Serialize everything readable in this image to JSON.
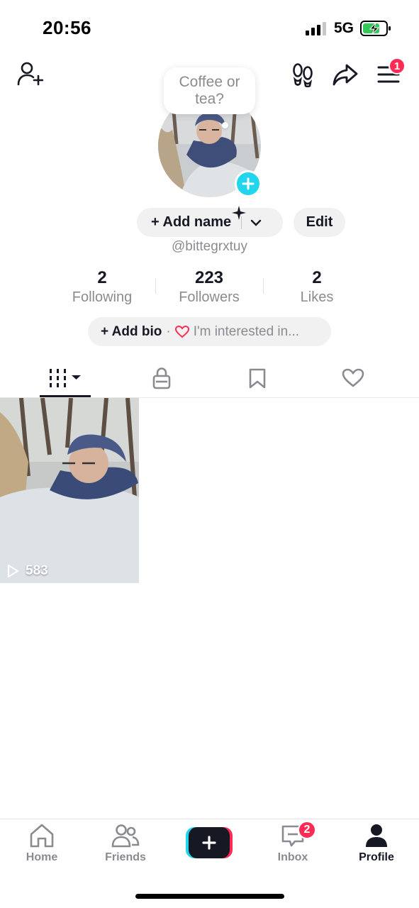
{
  "status_bar": {
    "time": "20:56",
    "network": "5G"
  },
  "header": {
    "menu_badge": "1"
  },
  "bubble": {
    "text": "Coffee or tea?"
  },
  "profile": {
    "add_name_label": "+ Add name",
    "edit_label": "Edit",
    "username": "@bittegrxtuy"
  },
  "stats": [
    {
      "value": "2",
      "label": "Following"
    },
    {
      "value": "223",
      "label": "Followers"
    },
    {
      "value": "2",
      "label": "Likes"
    }
  ],
  "bio": {
    "add_bio_label": "+ Add bio",
    "separator": "·",
    "interest_label": "I'm interested in..."
  },
  "tabs": [
    "videos-grid",
    "private-lock",
    "saved-bookmark",
    "liked-heart"
  ],
  "videos": [
    {
      "views": "583"
    }
  ],
  "nav": {
    "home": "Home",
    "friends": "Friends",
    "inbox": "Inbox",
    "inbox_badge": "2",
    "profile": "Profile"
  },
  "colors": {
    "accent_pink": "#fe2c55",
    "accent_cyan": "#20d5ec",
    "text": "#161823",
    "muted": "#8a8b91"
  }
}
